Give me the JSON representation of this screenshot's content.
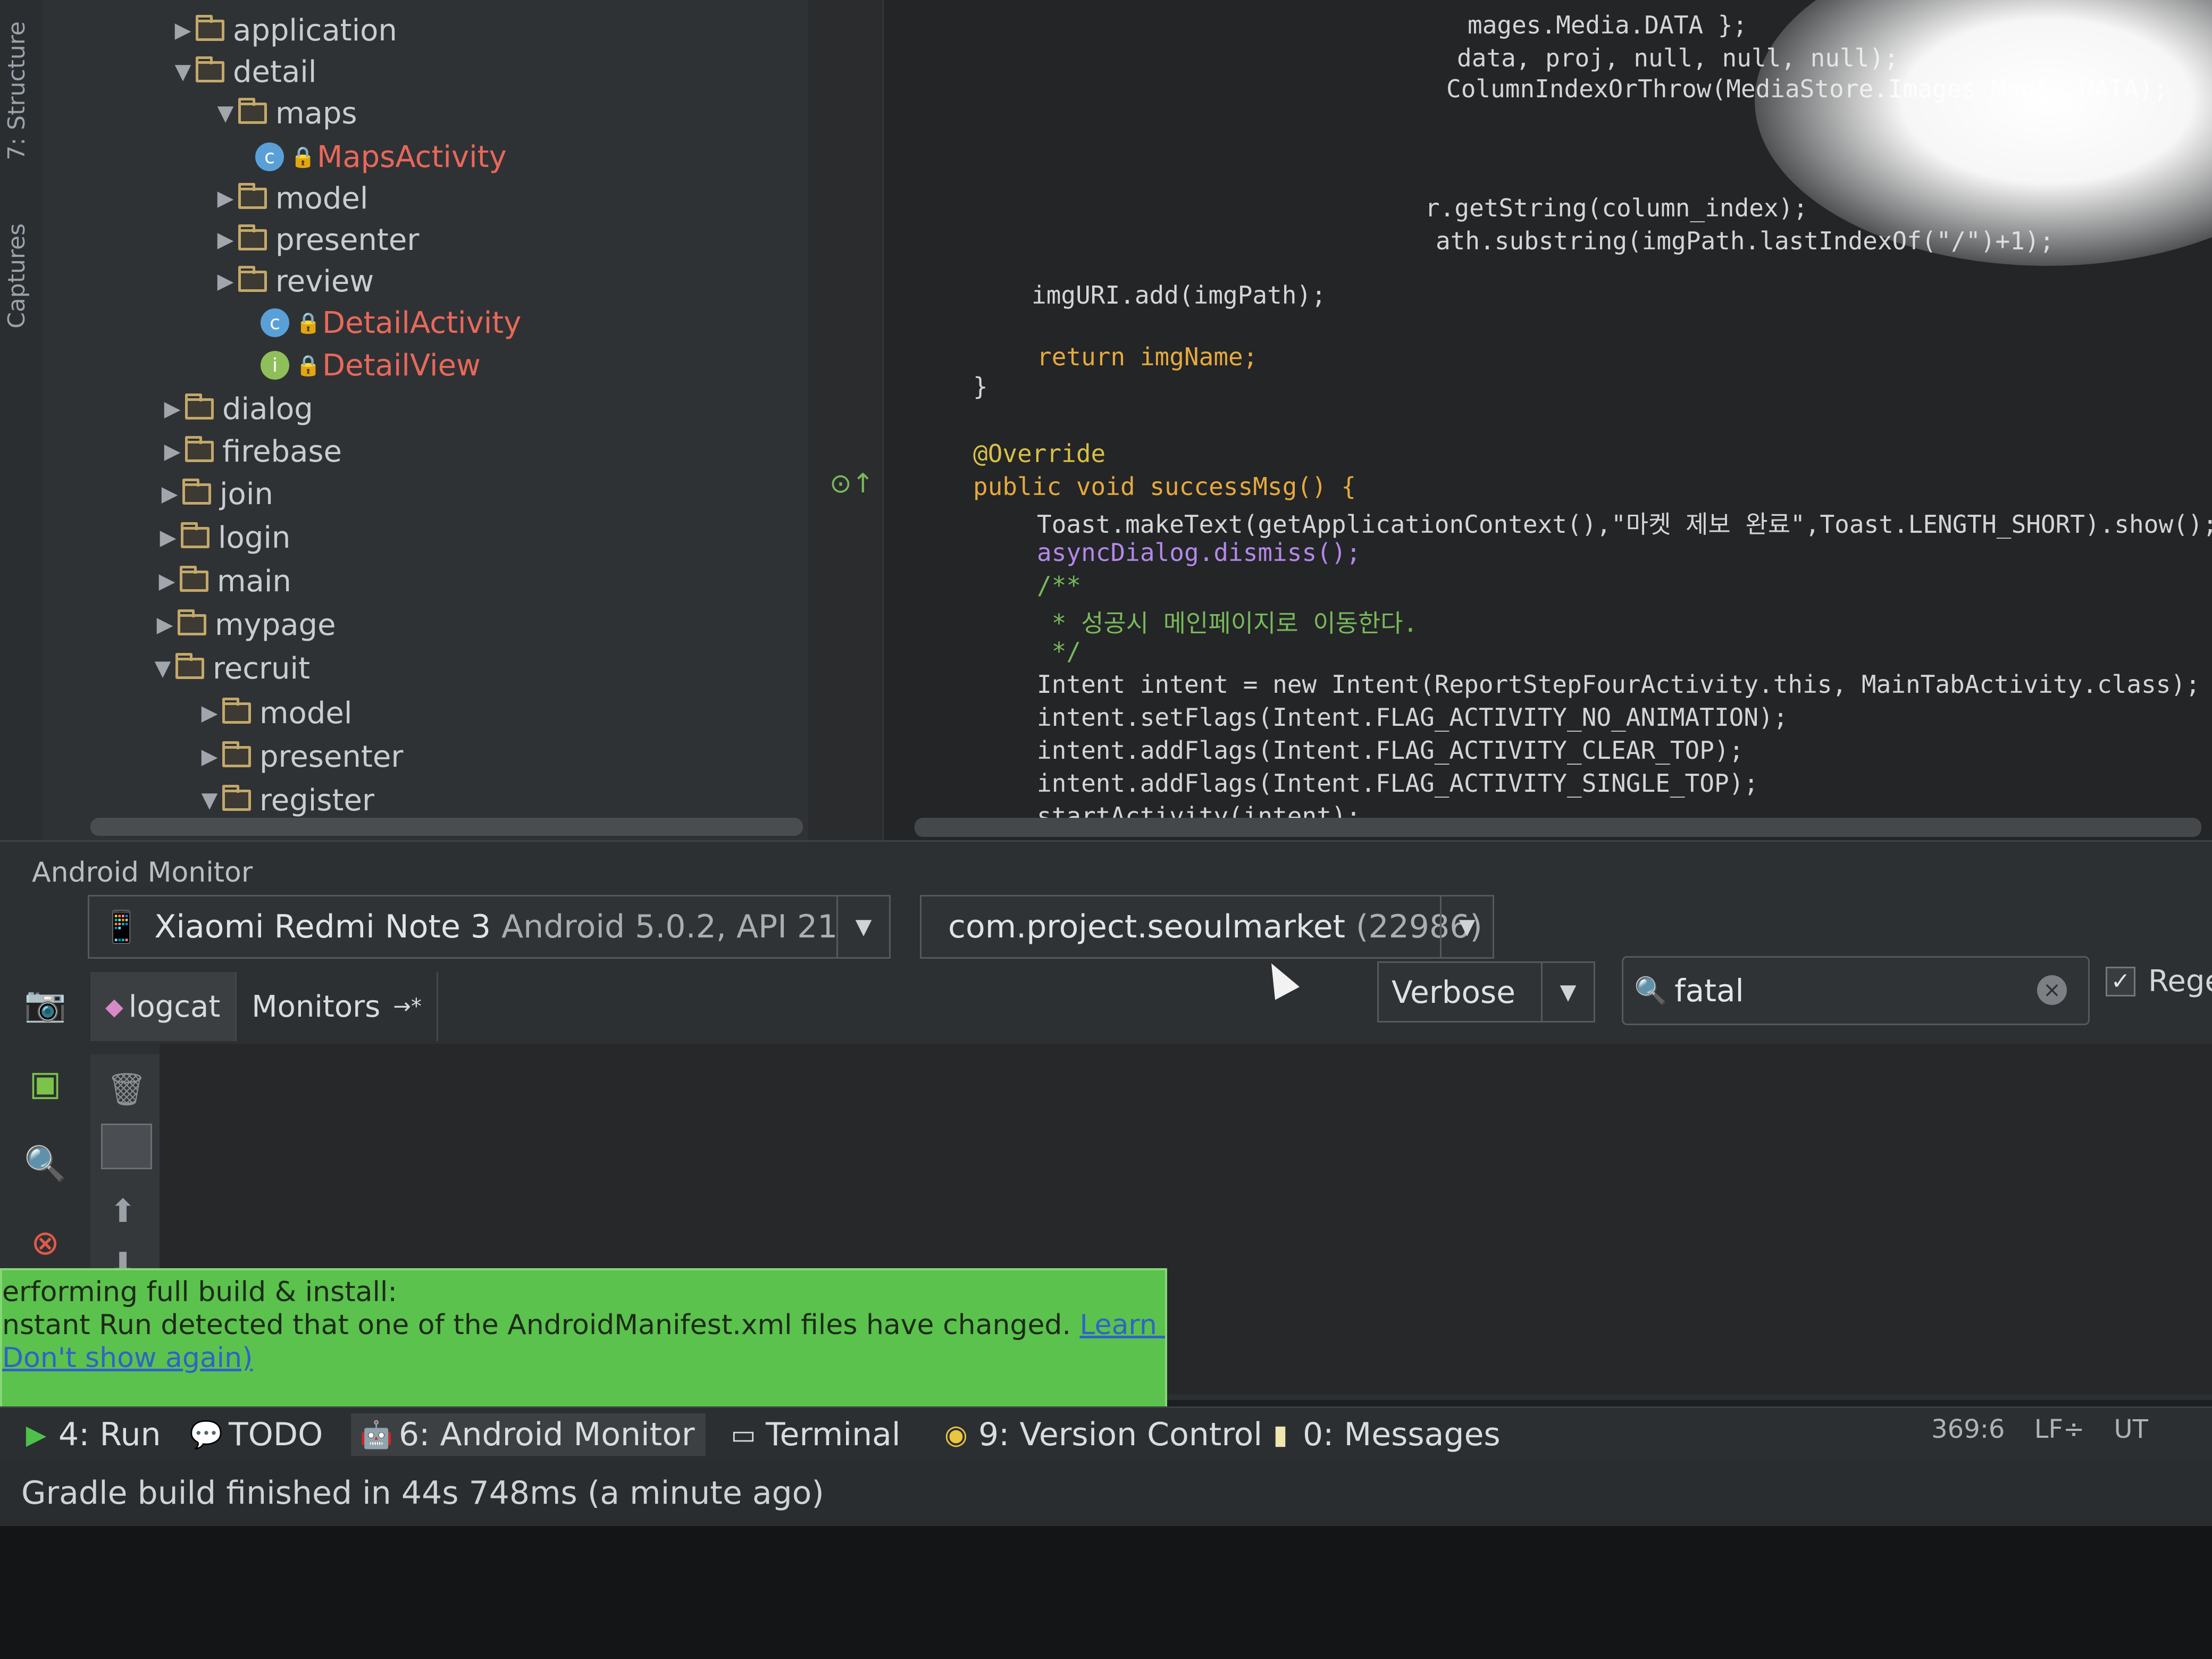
{
  "left_strip": {
    "tab_structure": "7: Structure",
    "tab_captures": "Captures"
  },
  "project_tree": {
    "rows": [
      {
        "label": "application",
        "kind": "folder",
        "expanded": false
      },
      {
        "label": "detail",
        "kind": "folder",
        "expanded": true
      },
      {
        "label": "maps",
        "kind": "folder",
        "expanded": true
      },
      {
        "label": "MapsActivity",
        "kind": "class"
      },
      {
        "label": "model",
        "kind": "folder",
        "expanded": false
      },
      {
        "label": "presenter",
        "kind": "folder",
        "expanded": false
      },
      {
        "label": "review",
        "kind": "folder",
        "expanded": false
      },
      {
        "label": "DetailActivity",
        "kind": "class"
      },
      {
        "label": "DetailView",
        "kind": "interface"
      },
      {
        "label": "dialog",
        "kind": "folder",
        "expanded": false
      },
      {
        "label": "firebase",
        "kind": "folder",
        "expanded": false
      },
      {
        "label": "join",
        "kind": "folder",
        "expanded": false
      },
      {
        "label": "login",
        "kind": "folder",
        "expanded": false
      },
      {
        "label": "main",
        "kind": "folder",
        "expanded": false
      },
      {
        "label": "mypage",
        "kind": "folder",
        "expanded": false
      },
      {
        "label": "recruit",
        "kind": "folder",
        "expanded": true
      },
      {
        "label": "model",
        "kind": "folder",
        "expanded": false
      },
      {
        "label": "presenter",
        "kind": "folder",
        "expanded": false
      },
      {
        "label": "register",
        "kind": "folder",
        "expanded": true
      }
    ]
  },
  "editor": {
    "lines": [
      "mages.Media.DATA };",
      "data, proj, null, null, null);",
      "ColumnIndexOrThrow(MediaStore.Images.Media.DATA);",
      "r.getString(column_index);",
      "ath.substring(imgPath.lastIndexOf(\"/\")+1);",
      "imgURI.add(imgPath);",
      "return imgName;",
      "}",
      "@Override",
      "public void successMsg() {",
      "Toast.makeText(getApplicationContext(),\"마켓 제보 완료\",Toast.LENGTH_SHORT).show();",
      "asyncDialog.dismiss();",
      "/**",
      " * 성공시 메인페이지로 이동한다.",
      " */",
      "Intent intent = new Intent(ReportStepFourActivity.this, MainTabActivity.class);",
      "intent.setFlags(Intent.FLAG_ACTIVITY_NO_ANIMATION);",
      "intent.addFlags(Intent.FLAG_ACTIVITY_CLEAR_TOP);",
      "intent.addFlags(Intent.FLAG_ACTIVITY_SINGLE_TOP);",
      "startActivity(intent);"
    ]
  },
  "monitor": {
    "title": "Android Monitor",
    "device_name": "Xiaomi Redmi Note 3",
    "device_os": "Android 5.0.2, API 21",
    "process_name": "com.project.seoulmarket",
    "process_pid": "(22986)",
    "tabs": [
      "logcat",
      "Monitors"
    ],
    "log_level": "Verbose",
    "filter_value": "fatal",
    "regex_label": "Rege",
    "regex_checked": true
  },
  "balloon": {
    "line1": "erforming full build & install:",
    "line2": "nstant Run detected that one of the AndroidManifest.xml files have changed.",
    "learn_more": "Learn More",
    "line3": "Don't show again)"
  },
  "tool_windows": {
    "run": "4: Run",
    "todo": "TODO",
    "android_monitor": "6: Android Monitor",
    "terminal": "Terminal",
    "version_control": "9: Version Control",
    "messages": "0: Messages"
  },
  "status": {
    "message": "Gradle build finished in 44s 748ms (a minute ago)",
    "position": "369:6",
    "line_sep": "LF÷",
    "encoding": "UT"
  },
  "colors": {
    "balloon_green": "#5bc24d",
    "error_red": "#e8685b",
    "keyword_orange": "#e6a93d"
  }
}
